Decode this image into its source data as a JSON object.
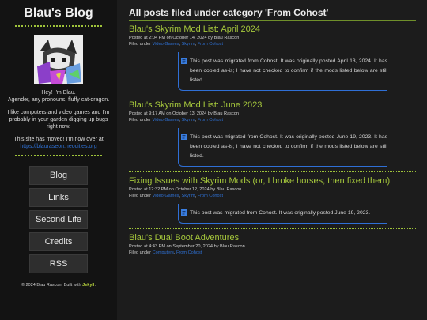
{
  "sidebar": {
    "blog_title": "Blau's Blog",
    "bio_line1": "Hey! I'm Blau.",
    "bio_line2": "Agender, any pronouns, fluffy cat-dragon.",
    "bio_para2": "I like computers and video games and I'm probably in your garden digging up bugs right now.",
    "moved_text": "This site has moved! I'm now over at",
    "moved_link": "https://blauraseon.neocities.org",
    "nav": [
      "Blog",
      "Links",
      "Second Life",
      "Credits",
      "RSS"
    ],
    "footer_text": "© 2024 Blau Rascon. Built with",
    "footer_link": "Jekyll",
    "footer_end": "."
  },
  "main": {
    "heading": "All posts filed under category 'From Cohost'",
    "posts": [
      {
        "title": "Blau's Skyrim Mod List: April 2024",
        "posted": "Posted at 2:04 PM on October 14, 2024 by Blau Rascon",
        "filed_label": "Filed under",
        "categories": [
          "Video Games",
          "Skyrim",
          "From Cohost"
        ],
        "note": "This post was migrated from Cohost. It was originally posted April 13, 2024. It has been copied as-is; I have not checked to confirm if the mods listed below are still listed."
      },
      {
        "title": "Blau's Skyrim Mod List: June 2023",
        "posted": "Posted at 9:17 AM on October 13, 2024 by Blau Rascon",
        "filed_label": "Filed under",
        "categories": [
          "Video Games",
          "Skyrim",
          "From Cohost"
        ],
        "note": "This post was migrated from Cohost. It was originally posted June 19, 2023. It has been copied as-is; I have not checked to confirm if the mods listed below are still listed."
      },
      {
        "title": "Fixing Issues with Skyrim Mods (or, I broke horses, then fixed them)",
        "posted": "Posted at 12:32 PM on October 12, 2024 by Blau Rascon",
        "filed_label": "Filed under",
        "categories": [
          "Video Games",
          "Skyrim",
          "From Cohost"
        ],
        "note": "This post was migrated from Cohost. It was originally posted June 19, 2023."
      },
      {
        "title": "Blau's Dual Boot Adventures",
        "posted": "Posted at 4:43 PM on September 20, 2024 by Blau Rascon",
        "filed_label": "Filed under",
        "categories": [
          "Computers",
          "From Cohost"
        ]
      }
    ]
  },
  "colors": {
    "accent_green": "#a6c83c",
    "link_blue": "#2e6fd1",
    "note_border": "#2f6fd6"
  },
  "icons": {
    "note": "document-icon"
  }
}
